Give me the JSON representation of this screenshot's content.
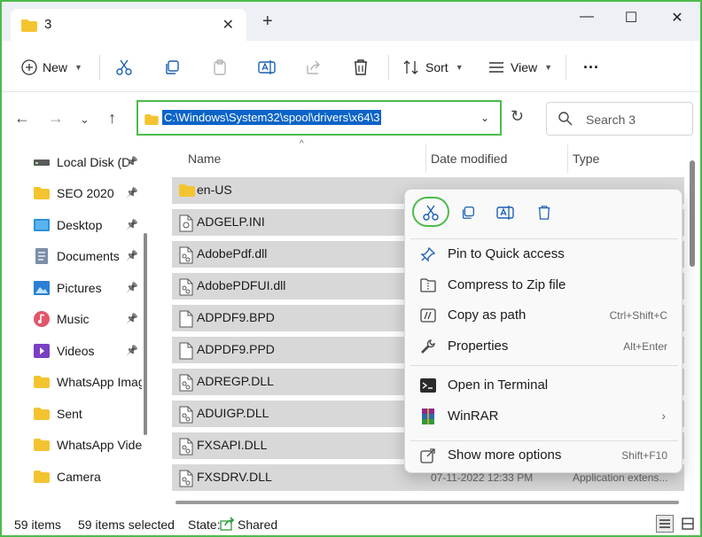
{
  "tab": {
    "title": "3",
    "close": "✕",
    "new_tab": "+"
  },
  "window_controls": {
    "minimize": "—",
    "maximize": "☐",
    "close": "✕"
  },
  "toolbar": {
    "new_label": "New",
    "sort_label": "Sort",
    "view_label": "View",
    "more_label": "···"
  },
  "address": {
    "path": "C:\\Windows\\System32\\spool\\drivers\\x64\\3",
    "search_placeholder": "Search 3"
  },
  "sidebar": {
    "items": [
      {
        "label": "Local Disk (D",
        "icon": "drive-icon",
        "pinned": true
      },
      {
        "label": "SEO 2020",
        "icon": "folder-icon",
        "pinned": true
      },
      {
        "label": "Desktop",
        "icon": "desktop-icon",
        "pinned": true
      },
      {
        "label": "Documents",
        "icon": "documents-icon",
        "pinned": true
      },
      {
        "label": "Pictures",
        "icon": "pictures-icon",
        "pinned": true
      },
      {
        "label": "Music",
        "icon": "music-icon",
        "pinned": true
      },
      {
        "label": "Videos",
        "icon": "videos-icon",
        "pinned": true
      },
      {
        "label": "WhatsApp Imag",
        "icon": "folder-icon",
        "pinned": false
      },
      {
        "label": "Sent",
        "icon": "folder-icon",
        "pinned": false
      },
      {
        "label": "WhatsApp Vide",
        "icon": "folder-icon",
        "pinned": false
      },
      {
        "label": "Camera",
        "icon": "folder-icon",
        "pinned": false
      }
    ]
  },
  "columns": {
    "name": "Name",
    "date": "Date modified",
    "type": "Type"
  },
  "files": [
    {
      "name": "en-US",
      "kind": "folder",
      "date": "",
      "type": ""
    },
    {
      "name": "ADGELP.INI",
      "kind": "ini",
      "date": "",
      "type": ""
    },
    {
      "name": "AdobePdf.dll",
      "kind": "dll",
      "date": "",
      "type": ""
    },
    {
      "name": "AdobePDFUI.dll",
      "kind": "dll",
      "date": "",
      "type": ""
    },
    {
      "name": "ADPDF9.BPD",
      "kind": "file",
      "date": "",
      "type": ""
    },
    {
      "name": "ADPDF9.PPD",
      "kind": "file",
      "date": "",
      "type": ""
    },
    {
      "name": "ADREGP.DLL",
      "kind": "dll",
      "date": "",
      "type": ""
    },
    {
      "name": "ADUIGP.DLL",
      "kind": "dll",
      "date": "",
      "type": ""
    },
    {
      "name": "FXSAPI.DLL",
      "kind": "dll",
      "date": "",
      "type": ""
    },
    {
      "name": "FXSDRV.DLL",
      "kind": "dll",
      "date": "07-11-2022 12:33 PM",
      "type": "Application extens..."
    }
  ],
  "context_menu": {
    "items": [
      {
        "label": "Pin to Quick access",
        "shortcut": "",
        "icon": "pin-icon"
      },
      {
        "label": "Compress to Zip file",
        "shortcut": "",
        "icon": "zip-icon"
      },
      {
        "label": "Copy as path",
        "shortcut": "Ctrl+Shift+C",
        "icon": "copy-path-icon"
      },
      {
        "label": "Properties",
        "shortcut": "Alt+Enter",
        "icon": "wrench-icon"
      },
      {
        "label": "Open in Terminal",
        "shortcut": "",
        "icon": "terminal-icon"
      },
      {
        "label": "WinRAR",
        "shortcut": "",
        "icon": "winrar-icon",
        "submenu": "›"
      },
      {
        "label": "Show more options",
        "shortcut": "Shift+F10",
        "icon": "more-options-icon"
      }
    ]
  },
  "status": {
    "count": "59 items",
    "selected": "59 items selected",
    "state_label": "State:",
    "state_value": "Shared"
  },
  "colors": {
    "accent": "#0a64c8",
    "highlight": "#4cbb4c",
    "folder": "#f4c430",
    "selection": "#d8d8d8"
  }
}
